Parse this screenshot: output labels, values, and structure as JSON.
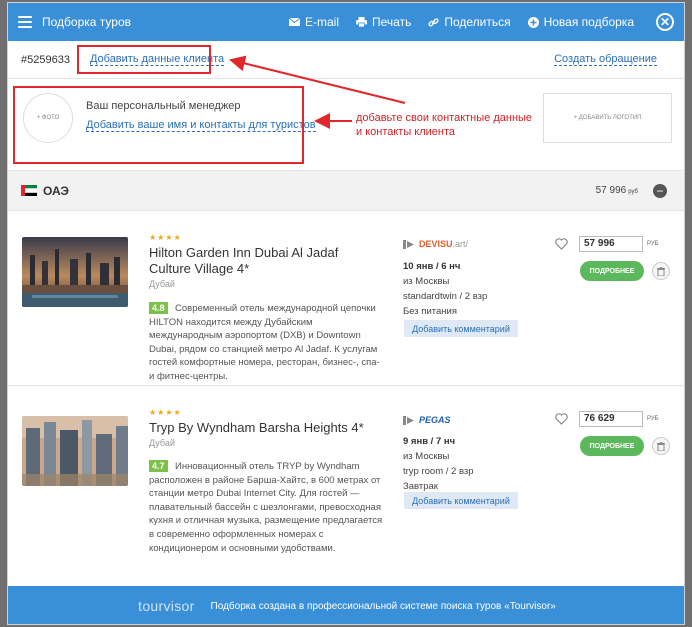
{
  "header": {
    "title": "Подборка туров",
    "email_label": "E-mail",
    "print_label": "Печать",
    "share_label": "Поделиться",
    "new_label": "Новая подборка",
    "icons": [
      "menu-icon",
      "mail-icon",
      "print-icon",
      "link-icon",
      "plus-icon",
      "close-icon"
    ]
  },
  "idrow": {
    "tour_id": "#5259633",
    "add_client_label": "Добавить данные клиента",
    "create_request_label": "Создать обращение"
  },
  "manager": {
    "photo_label": "+ ФОТО",
    "title": "Ваш персональный менеджер",
    "link": "Добавить ваше имя и контакты для туристов",
    "logo_label": "+ ДОБАВИТЬ ЛОГОТИП"
  },
  "annotation": "добавьте свои контактные данные и контакты клиента",
  "country": {
    "name": "ОАЭ",
    "total": "57 996",
    "currency": "руб",
    "flag_colors": [
      "#e2262b",
      "#00843d",
      "#ffffff",
      "#000000"
    ]
  },
  "hotels": [
    {
      "stars": "★★★★",
      "name": "Hilton Garden Inn Dubai Al Jadaf Culture Village 4*",
      "city": "Дубай",
      "rating": "4.8",
      "description": "Современный отель международной цепочки HILTON находится между Дубайским международным аэропортом (DXB) и Downtown Dubai, рядом со станцией метро Al Jadaf. К услугам гостей комфортные номера, ресторан, бизнес-, спа- и фитнес-центры.",
      "operator": "DEVISU",
      "operator_suffix": ".art/",
      "dates": "10 янв / 6 нч",
      "from": "из Москвы",
      "room": "standardtwin / 2 взр",
      "meal": "Без питания",
      "comment_label": "Добавить комментарий",
      "price": "57 996",
      "currency": "РУБ",
      "more_label": "ПОДРОБНЕЕ"
    },
    {
      "stars": "★★★★",
      "name": "Tryp By Wyndham Barsha Heights 4*",
      "city": "Дубай",
      "rating": "4.7",
      "description": "Инновационный отель TRYP by Wyndham расположен в районе Барша-Хайтс, в 600 метрах от станции метро Dubai Internet City. Для гостей — плавательный бассейн с шезлонгами, превосходная кухня и отличная музыка, размещение предлагается в современно оформленных номерах с кондиционером и основными удобствами.",
      "operator": "PEGAS",
      "dates": "9 янв / 7 нч",
      "from": "из Москвы",
      "room": "tryp room / 2 взр",
      "meal": "Завтрак",
      "comment_label": "Добавить комментарий",
      "price": "76 629",
      "currency": "РУБ",
      "more_label": "ПОДРОБНЕЕ"
    }
  ],
  "footer": {
    "brand": "tourvisor",
    "text": "Подборка создана в профессиональной системе поиска туров «Tourvisor»"
  },
  "colors": {
    "header_blue": "#3a8fd9",
    "link_blue": "#2a6fb5",
    "annotation_red": "#e2262b",
    "rating_green": "#7dc14a",
    "button_green": "#5cb85c",
    "star_orange": "#f0a71c"
  }
}
